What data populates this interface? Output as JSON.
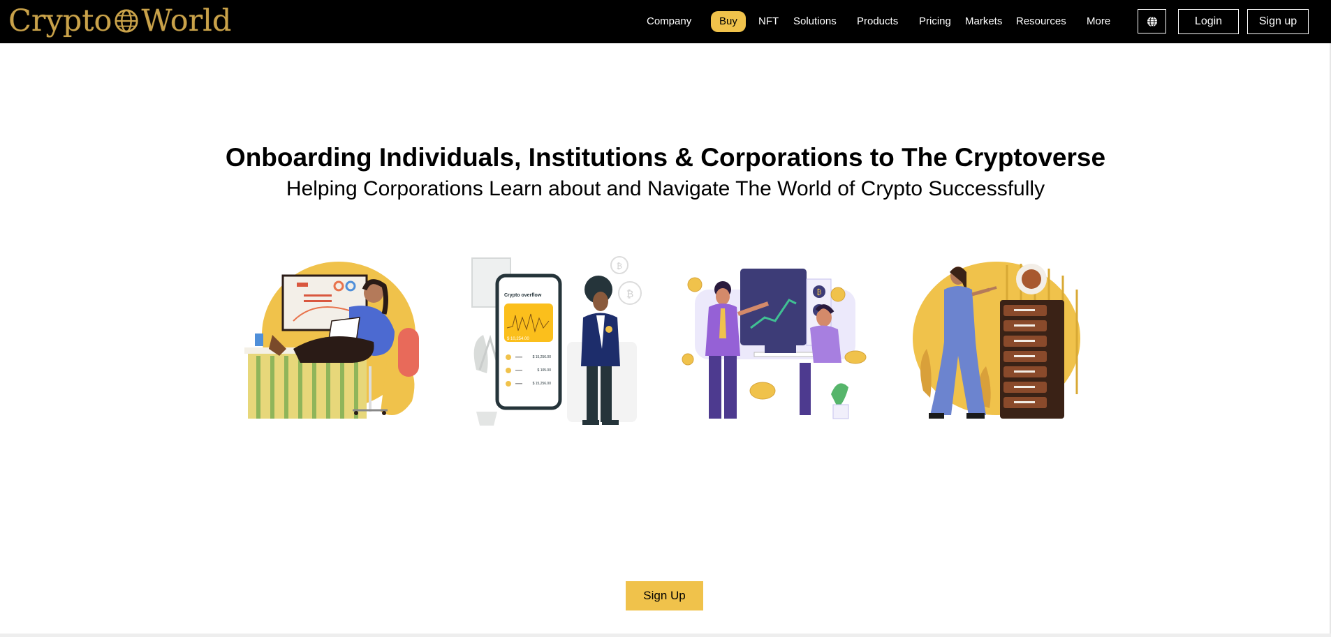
{
  "brand": {
    "logo_left": "Crypto",
    "logo_right": "World"
  },
  "nav": {
    "company": "Company",
    "buy": "Buy",
    "nft": "NFT",
    "solutions": "Solutions",
    "products": "Products",
    "pricing": "Pricing",
    "markets": "Markets",
    "resources": "Resources",
    "more": "More"
  },
  "actions": {
    "login": "Login",
    "signup": "Sign up"
  },
  "hero": {
    "title": "Onboarding Individuals, Institutions & Corporations to The Cryptoverse",
    "subtitle": "Helping Corporations Learn about and Navigate The World of Crypto Successfully"
  },
  "cta": {
    "signup": "Sign Up"
  },
  "phone_card": {
    "app_title": "Crypto overflow",
    "balance": "$ 10,254.00",
    "rows": [
      "$ 15,256.00",
      "$ 105.00",
      "$ 15,256.00"
    ]
  },
  "icons": {
    "globe": "globe-icon",
    "coin": "coin-icon"
  },
  "colors": {
    "accent": "#f0c24b",
    "topbar": "#000000",
    "logo": "#c9a24a"
  }
}
